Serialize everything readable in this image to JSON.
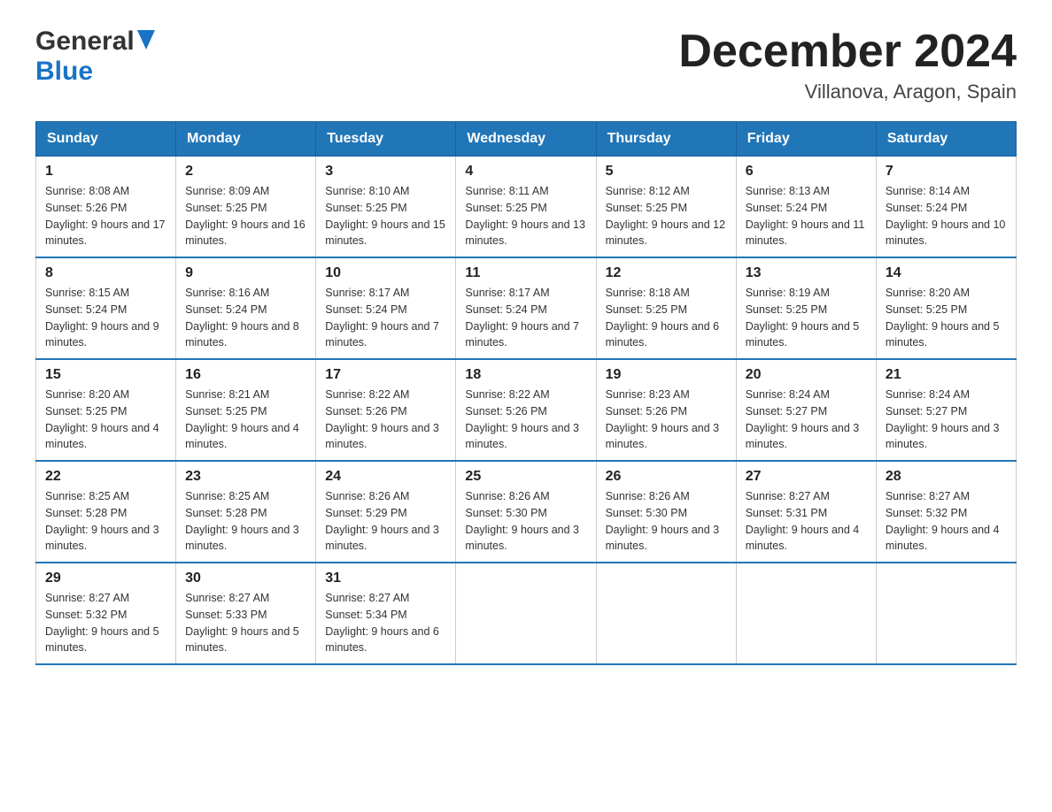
{
  "header": {
    "logo_general": "General",
    "logo_blue": "Blue",
    "month_title": "December 2024",
    "location": "Villanova, Aragon, Spain"
  },
  "days_of_week": [
    "Sunday",
    "Monday",
    "Tuesday",
    "Wednesday",
    "Thursday",
    "Friday",
    "Saturday"
  ],
  "weeks": [
    [
      {
        "day": "1",
        "sunrise": "8:08 AM",
        "sunset": "5:26 PM",
        "daylight": "9 hours and 17 minutes."
      },
      {
        "day": "2",
        "sunrise": "8:09 AM",
        "sunset": "5:25 PM",
        "daylight": "9 hours and 16 minutes."
      },
      {
        "day": "3",
        "sunrise": "8:10 AM",
        "sunset": "5:25 PM",
        "daylight": "9 hours and 15 minutes."
      },
      {
        "day": "4",
        "sunrise": "8:11 AM",
        "sunset": "5:25 PM",
        "daylight": "9 hours and 13 minutes."
      },
      {
        "day": "5",
        "sunrise": "8:12 AM",
        "sunset": "5:25 PM",
        "daylight": "9 hours and 12 minutes."
      },
      {
        "day": "6",
        "sunrise": "8:13 AM",
        "sunset": "5:24 PM",
        "daylight": "9 hours and 11 minutes."
      },
      {
        "day": "7",
        "sunrise": "8:14 AM",
        "sunset": "5:24 PM",
        "daylight": "9 hours and 10 minutes."
      }
    ],
    [
      {
        "day": "8",
        "sunrise": "8:15 AM",
        "sunset": "5:24 PM",
        "daylight": "9 hours and 9 minutes."
      },
      {
        "day": "9",
        "sunrise": "8:16 AM",
        "sunset": "5:24 PM",
        "daylight": "9 hours and 8 minutes."
      },
      {
        "day": "10",
        "sunrise": "8:17 AM",
        "sunset": "5:24 PM",
        "daylight": "9 hours and 7 minutes."
      },
      {
        "day": "11",
        "sunrise": "8:17 AM",
        "sunset": "5:24 PM",
        "daylight": "9 hours and 7 minutes."
      },
      {
        "day": "12",
        "sunrise": "8:18 AM",
        "sunset": "5:25 PM",
        "daylight": "9 hours and 6 minutes."
      },
      {
        "day": "13",
        "sunrise": "8:19 AM",
        "sunset": "5:25 PM",
        "daylight": "9 hours and 5 minutes."
      },
      {
        "day": "14",
        "sunrise": "8:20 AM",
        "sunset": "5:25 PM",
        "daylight": "9 hours and 5 minutes."
      }
    ],
    [
      {
        "day": "15",
        "sunrise": "8:20 AM",
        "sunset": "5:25 PM",
        "daylight": "9 hours and 4 minutes."
      },
      {
        "day": "16",
        "sunrise": "8:21 AM",
        "sunset": "5:25 PM",
        "daylight": "9 hours and 4 minutes."
      },
      {
        "day": "17",
        "sunrise": "8:22 AM",
        "sunset": "5:26 PM",
        "daylight": "9 hours and 3 minutes."
      },
      {
        "day": "18",
        "sunrise": "8:22 AM",
        "sunset": "5:26 PM",
        "daylight": "9 hours and 3 minutes."
      },
      {
        "day": "19",
        "sunrise": "8:23 AM",
        "sunset": "5:26 PM",
        "daylight": "9 hours and 3 minutes."
      },
      {
        "day": "20",
        "sunrise": "8:24 AM",
        "sunset": "5:27 PM",
        "daylight": "9 hours and 3 minutes."
      },
      {
        "day": "21",
        "sunrise": "8:24 AM",
        "sunset": "5:27 PM",
        "daylight": "9 hours and 3 minutes."
      }
    ],
    [
      {
        "day": "22",
        "sunrise": "8:25 AM",
        "sunset": "5:28 PM",
        "daylight": "9 hours and 3 minutes."
      },
      {
        "day": "23",
        "sunrise": "8:25 AM",
        "sunset": "5:28 PM",
        "daylight": "9 hours and 3 minutes."
      },
      {
        "day": "24",
        "sunrise": "8:26 AM",
        "sunset": "5:29 PM",
        "daylight": "9 hours and 3 minutes."
      },
      {
        "day": "25",
        "sunrise": "8:26 AM",
        "sunset": "5:30 PM",
        "daylight": "9 hours and 3 minutes."
      },
      {
        "day": "26",
        "sunrise": "8:26 AM",
        "sunset": "5:30 PM",
        "daylight": "9 hours and 3 minutes."
      },
      {
        "day": "27",
        "sunrise": "8:27 AM",
        "sunset": "5:31 PM",
        "daylight": "9 hours and 4 minutes."
      },
      {
        "day": "28",
        "sunrise": "8:27 AM",
        "sunset": "5:32 PM",
        "daylight": "9 hours and 4 minutes."
      }
    ],
    [
      {
        "day": "29",
        "sunrise": "8:27 AM",
        "sunset": "5:32 PM",
        "daylight": "9 hours and 5 minutes."
      },
      {
        "day": "30",
        "sunrise": "8:27 AM",
        "sunset": "5:33 PM",
        "daylight": "9 hours and 5 minutes."
      },
      {
        "day": "31",
        "sunrise": "8:27 AM",
        "sunset": "5:34 PM",
        "daylight": "9 hours and 6 minutes."
      },
      null,
      null,
      null,
      null
    ]
  ]
}
